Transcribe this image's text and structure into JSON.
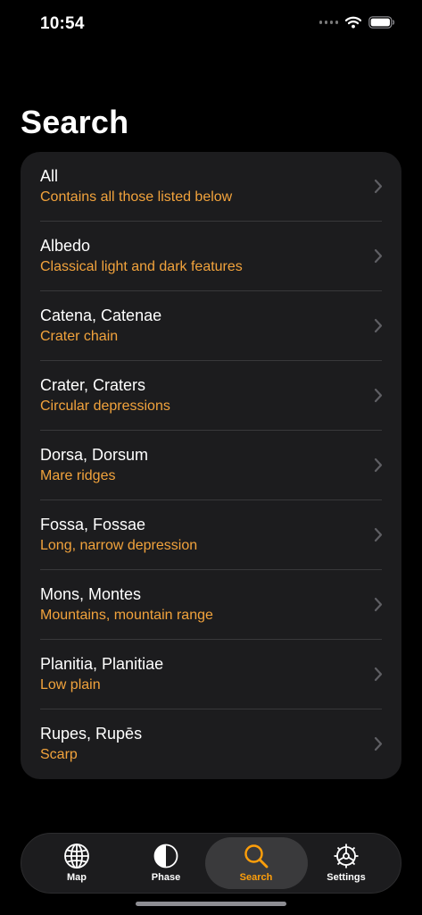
{
  "status_bar": {
    "time": "10:54"
  },
  "page": {
    "title": "Search"
  },
  "list": [
    {
      "title": "All",
      "subtitle": "Contains all those listed below"
    },
    {
      "title": "Albedo",
      "subtitle": "Classical light and dark features"
    },
    {
      "title": "Catena, Catenae",
      "subtitle": "Crater chain"
    },
    {
      "title": "Crater, Craters",
      "subtitle": "Circular depressions"
    },
    {
      "title": "Dorsa, Dorsum",
      "subtitle": "Mare ridges"
    },
    {
      "title": "Fossa, Fossae",
      "subtitle": "Long, narrow depression"
    },
    {
      "title": "Mons, Montes",
      "subtitle": "Mountains, mountain range"
    },
    {
      "title": "Planitia, Planitiae",
      "subtitle": "Low plain"
    },
    {
      "title": "Rupes, Rupēs",
      "subtitle": "Scarp"
    }
  ],
  "tab_bar": {
    "tabs": [
      {
        "label": "Map",
        "icon": "globe-icon"
      },
      {
        "label": "Phase",
        "icon": "moon-phase-icon"
      },
      {
        "label": "Search",
        "icon": "magnifier-icon",
        "active": true
      },
      {
        "label": "Settings",
        "icon": "gear-icon"
      }
    ],
    "active_color": "#ff9f0a"
  },
  "colors": {
    "background": "#000000",
    "card": "#1c1c1e",
    "subtitle": "#f2a33c",
    "accent": "#ff9f0a"
  }
}
